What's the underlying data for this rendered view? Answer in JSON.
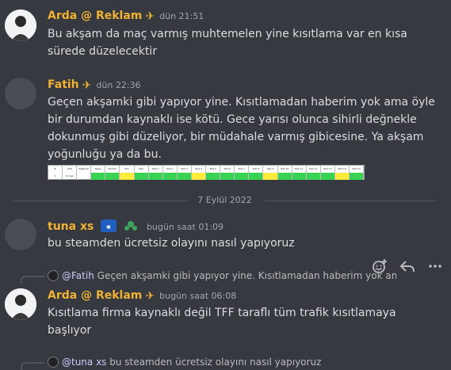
{
  "colors": {
    "background": "#36393f",
    "author_arda": "#f0b232",
    "author_fatih": "#f0b232",
    "author_tuna": "#f0b232",
    "text": "#dcddde",
    "timestamp": "#a3a6aa"
  },
  "messages": [
    {
      "author": "Arda @ Reklam",
      "tag_icon": "megaphone-icon",
      "timestamp": "dün 21:51",
      "lines": [
        "Bu akşam da maç varmış muhtemelen yine kısıtlama var en kısa",
        "sürede düzelecektir"
      ]
    },
    {
      "author": "Fatih",
      "tag_icon": "megaphone-icon",
      "timestamp": "dün 22:36",
      "lines": [
        "Geçen akşamki gibi yapıyor yine. Kısıtlamadan haberim yok ama öyle",
        "bir durumdan kaynaklı ise kötü. Gece yarısı olunca sihirli değnekle",
        "dokunmuş gibi düzeliyor, bir müdahale varmış gibicesine. Ya akşam",
        "yoğunluğu ya da bu."
      ]
    },
    {
      "author": "tuna xs",
      "timestamp": "bugün saat 01:09",
      "lines": [
        "bu steamden ücretsiz olayını nasıl yapıyoruz"
      ]
    },
    {
      "author": "Arda @ Reklam",
      "tag_icon": "megaphone-icon",
      "timestamp": "bugün saat 06:08",
      "reply_mention": "@Fatih",
      "reply_text": "Geçen akşamki gibi yapıyor yine. Kısıtlamadan haberim yok ama",
      "lines": [
        "Kısıtlama firma kaynaklı değil TFF taraflı tüm trafik kısıtlamaya",
        "başlıyor"
      ]
    }
  ],
  "bottom_reply": {
    "mention": "@tuna xs",
    "text": "bu steamden ücretsiz olayını nasıl yapıyoruz"
  },
  "date_divider": "7 Eylül 2022",
  "embed_table": {
    "header": [
      "#",
      "ASN Bağlantı Noktası",
      "Bağlantı Türü",
      "Mean",
      "Median",
      "Min",
      "Max",
      "Test 1",
      "Test 2",
      "Test 3",
      "Test 4",
      "Test 5",
      "Test 6",
      "Test 7",
      "Test 8",
      "Test 9",
      "Test 10",
      "Test 11",
      "Test 12",
      "Test 13",
      "Test 14",
      "Test 15"
    ],
    "row": [
      "1",
      "Turnge (Frankfurt)",
      ""
    ]
  },
  "toolbar": {
    "icons": [
      "add-reaction-icon",
      "reply-icon",
      "more-icon"
    ]
  }
}
